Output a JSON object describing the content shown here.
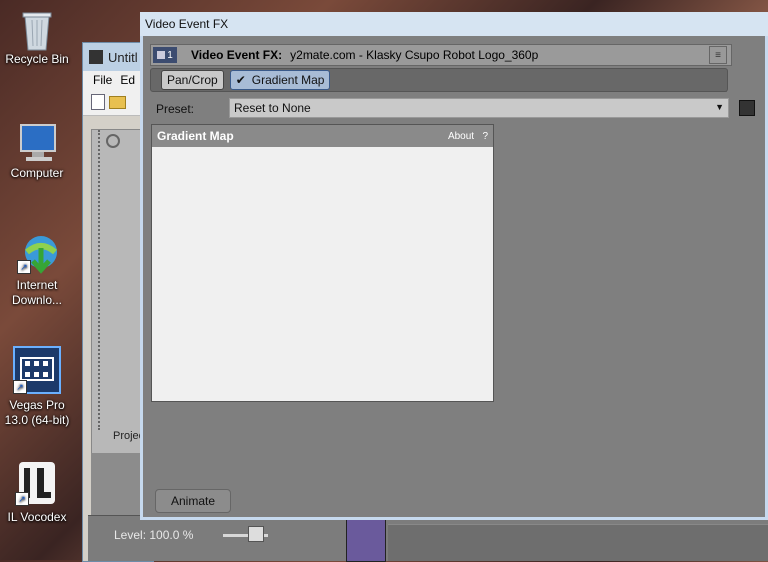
{
  "desktop": {
    "icons": [
      {
        "label": "Recycle Bin"
      },
      {
        "label": "Computer"
      },
      {
        "label": "Internet Downlo..."
      },
      {
        "label": "Vegas Pro 13.0 (64-bit)"
      },
      {
        "label": "IL Vocodex"
      }
    ]
  },
  "vegas": {
    "title": "Untitl",
    "menu": [
      "File",
      "Ed"
    ],
    "project_tab": "Projec"
  },
  "timeline": {
    "level_label": "Level: 100.0 %"
  },
  "fx": {
    "title": "Video Event FX",
    "header_num": "1",
    "header_label": "Video Event FX:",
    "media_name": "y2mate.com - Klasky Csupo Robot Logo_360p",
    "chain": [
      {
        "label": "Pan/Crop",
        "active": false
      },
      {
        "label": "Gradient Map",
        "active": true,
        "checked": true
      }
    ],
    "preset_label": "Preset:",
    "preset_value": "Reset to None",
    "plugin_title": "Gradient Map",
    "about_label": "About",
    "help_label": "?",
    "animate_label": "Animate"
  },
  "icons": [
    "recycle-bin-icon",
    "computer-icon",
    "internet-download-icon",
    "vegas-pro-icon",
    "vocodex-icon",
    "checkmark-icon",
    "save-icon",
    "dropdown-arrow-icon"
  ]
}
